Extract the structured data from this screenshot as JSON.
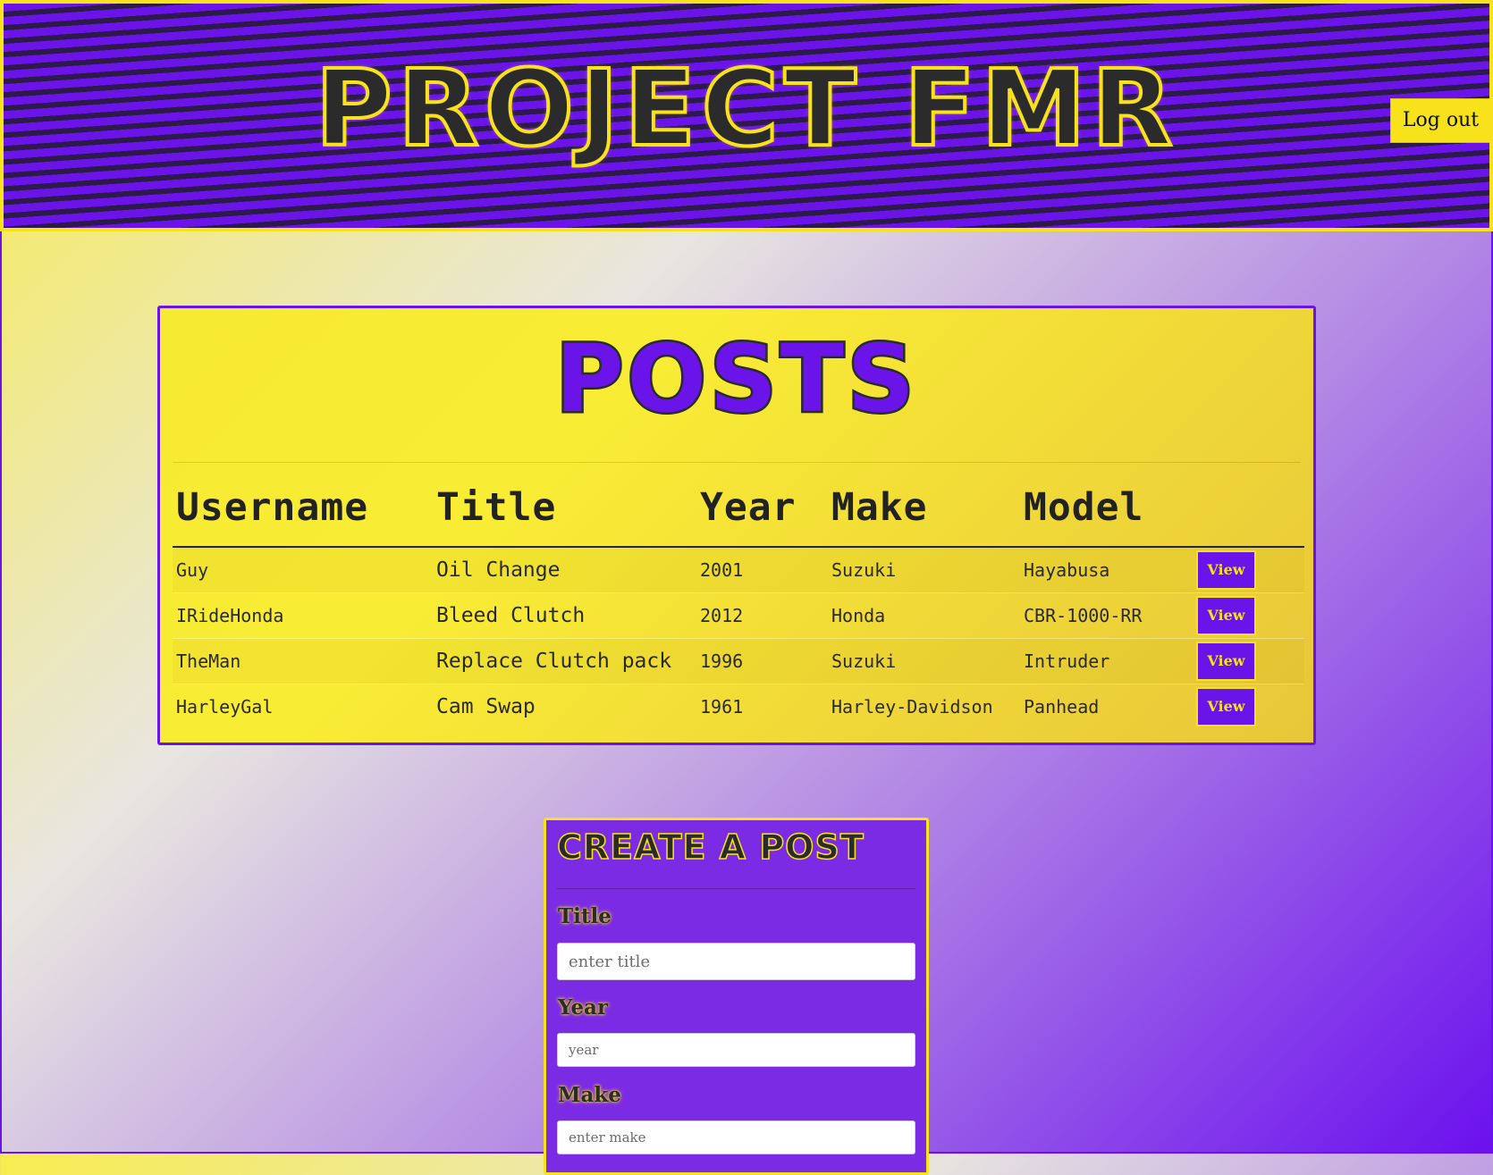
{
  "header": {
    "title": "PROJECT FMR",
    "logout_label": "Log out"
  },
  "posts": {
    "heading": "POSTS",
    "columns": [
      "Username",
      "Title",
      "Year",
      "Make",
      "Model"
    ],
    "rows": [
      {
        "username": "Guy",
        "title": "Oil Change",
        "year": "2001",
        "make": "Suzuki",
        "model": "Hayabusa",
        "action": "View"
      },
      {
        "username": "IRideHonda",
        "title": "Bleed Clutch",
        "year": "2012",
        "make": "Honda",
        "model": "CBR-1000-RR",
        "action": "View"
      },
      {
        "username": "TheMan",
        "title": "Replace Clutch pack",
        "year": "1996",
        "make": "Suzuki",
        "model": "Intruder",
        "action": "View"
      },
      {
        "username": "HarleyGal",
        "title": "Cam Swap",
        "year": "1961",
        "make": "Harley-Davidson",
        "model": "Panhead",
        "action": "View"
      }
    ]
  },
  "create": {
    "heading": "CREATE A POST",
    "title_label": "Title",
    "title_placeholder": "enter title",
    "year_label": "Year",
    "year_placeholder": "year",
    "make_label": "Make",
    "make_placeholder": "enter make"
  },
  "colors": {
    "purple": "#6a14ea",
    "yellow": "#f7e21b",
    "dark": "#2b2b2b"
  }
}
